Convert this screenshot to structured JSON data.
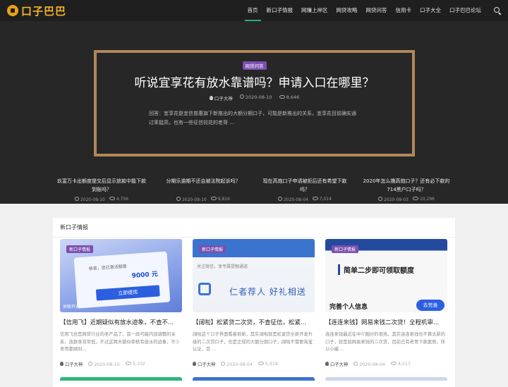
{
  "site": {
    "logo_text": "口子巴巴"
  },
  "nav": {
    "items": [
      {
        "label": "首页",
        "active": true
      },
      {
        "label": "新口子情报"
      },
      {
        "label": "网赚上岸区"
      },
      {
        "label": "网贷攻略"
      },
      {
        "label": "网贷问答"
      },
      {
        "label": "信用卡"
      },
      {
        "label": "口子大全"
      },
      {
        "label": "口子巴巴论坛"
      }
    ]
  },
  "hero": {
    "category": "网贷问答",
    "title": "听说宜享花有放水靠谱吗？申请入口在哪里？",
    "author": "口子大神",
    "date": "2020-08-10",
    "views": "8,646",
    "excerpt": "回答：宜享花是宜信普惠旗下新推出的大额分期口子，可能是新推出的关系，宜享花目前确实通过率挺高，也有一些征信较花的老哥 ..."
  },
  "hero_items": [
    {
      "title": "玖富万卡出额度提交后显示放款中能下款到账吗？",
      "date": "2020-08-10",
      "views": "4,756"
    },
    {
      "title": "分期乐逾期不还会被法院起诉吗？",
      "date": "2020-08-10",
      "views": "9,816"
    },
    {
      "title": "现在高炮口子申请被拒后还有希望下款吗？",
      "date": "2020-08-04",
      "views": "7,014"
    },
    {
      "title": "2020年怎么撸高炮口子？还有必下款的714黑户口子吗？",
      "date": "2020-08-03",
      "views": "10,296"
    }
  ],
  "section": {
    "title": "新口子情报",
    "cards": [
      {
        "tag": "新口子情报",
        "img_text_1": "恭喜，您已激活额度",
        "img_text_2": "9000 元",
        "img_button": "立即提现",
        "img_footer": "关联开通",
        "title": "【信用飞】近期疑似有放水迹象，不查不...",
        "excerpt": "信用飞也是网贷行业的老产品了，前一段可能内部调整的关系，放款率非常低，不过这两天貌似审核有放水的迹象，不少老哥都顺利...",
        "author": "口子大神",
        "date": "2020-08-10",
        "views": "5,102"
      },
      {
        "tag": "新口子情报",
        "img_text_1": "关注微信，享专属提额通道",
        "img_text_2": "仁者荐人 好礼相送",
        "title": "【阔啦】松紧贷二次贷，不查征信，松紧...",
        "excerpt": "阔啦这个口子界面看着很新，其实阔啦就是松紧贷全新开发升级的二次贷口子，也是正规的大额分期口子，阔啦不需要淘宝认证，目 ...",
        "author": "口子大神",
        "date": "2020-08-04",
        "views": "5,519"
      },
      {
        "tag": "新口子情报",
        "img_text_1": "简单二步即可领取额度",
        "img_text_2": "完善个人信息",
        "img_button": "去完善",
        "title": "【连连来钱】网易来钱二次贷！全程机审...",
        "excerpt": "连连来钱最近在中介圈炒的很热，其实连连来钱也不算太新的口子，就是前网易来钱的二次贷，目前已有老哥下款案例，所以小编 ...",
        "author": "口子大神",
        "date": "2020-08-04",
        "views": "4,517"
      }
    ]
  }
}
